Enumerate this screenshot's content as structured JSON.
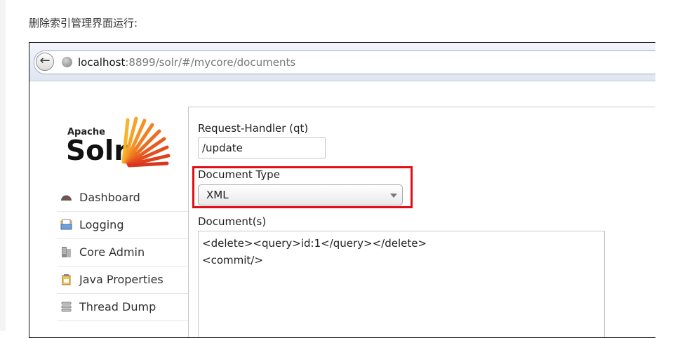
{
  "caption": "删除索引管理界面运行:",
  "browser": {
    "back_glyph": "←",
    "url_host": "localhost",
    "url_rest": ":8899/solr/#/mycore/documents"
  },
  "logo": {
    "apache": "Apache",
    "solr": "Solr"
  },
  "nav": {
    "items": [
      {
        "label": "Dashboard",
        "icon": "dashboard-icon"
      },
      {
        "label": "Logging",
        "icon": "logging-icon"
      },
      {
        "label": "Core Admin",
        "icon": "core-admin-icon"
      },
      {
        "label": "Java Properties",
        "icon": "java-properties-icon"
      },
      {
        "label": "Thread Dump",
        "icon": "thread-dump-icon"
      }
    ]
  },
  "form": {
    "request_handler_label": "Request-Handler (qt)",
    "request_handler_value": "/update",
    "document_type_label": "Document Type",
    "document_type_value": "XML",
    "documents_label": "Document(s)",
    "documents_lines": [
      "<delete><query>id:1</query></delete>",
      "<commit/>"
    ]
  },
  "colors": {
    "highlight": "#e10e16",
    "address_border": "#9fb0c4"
  }
}
